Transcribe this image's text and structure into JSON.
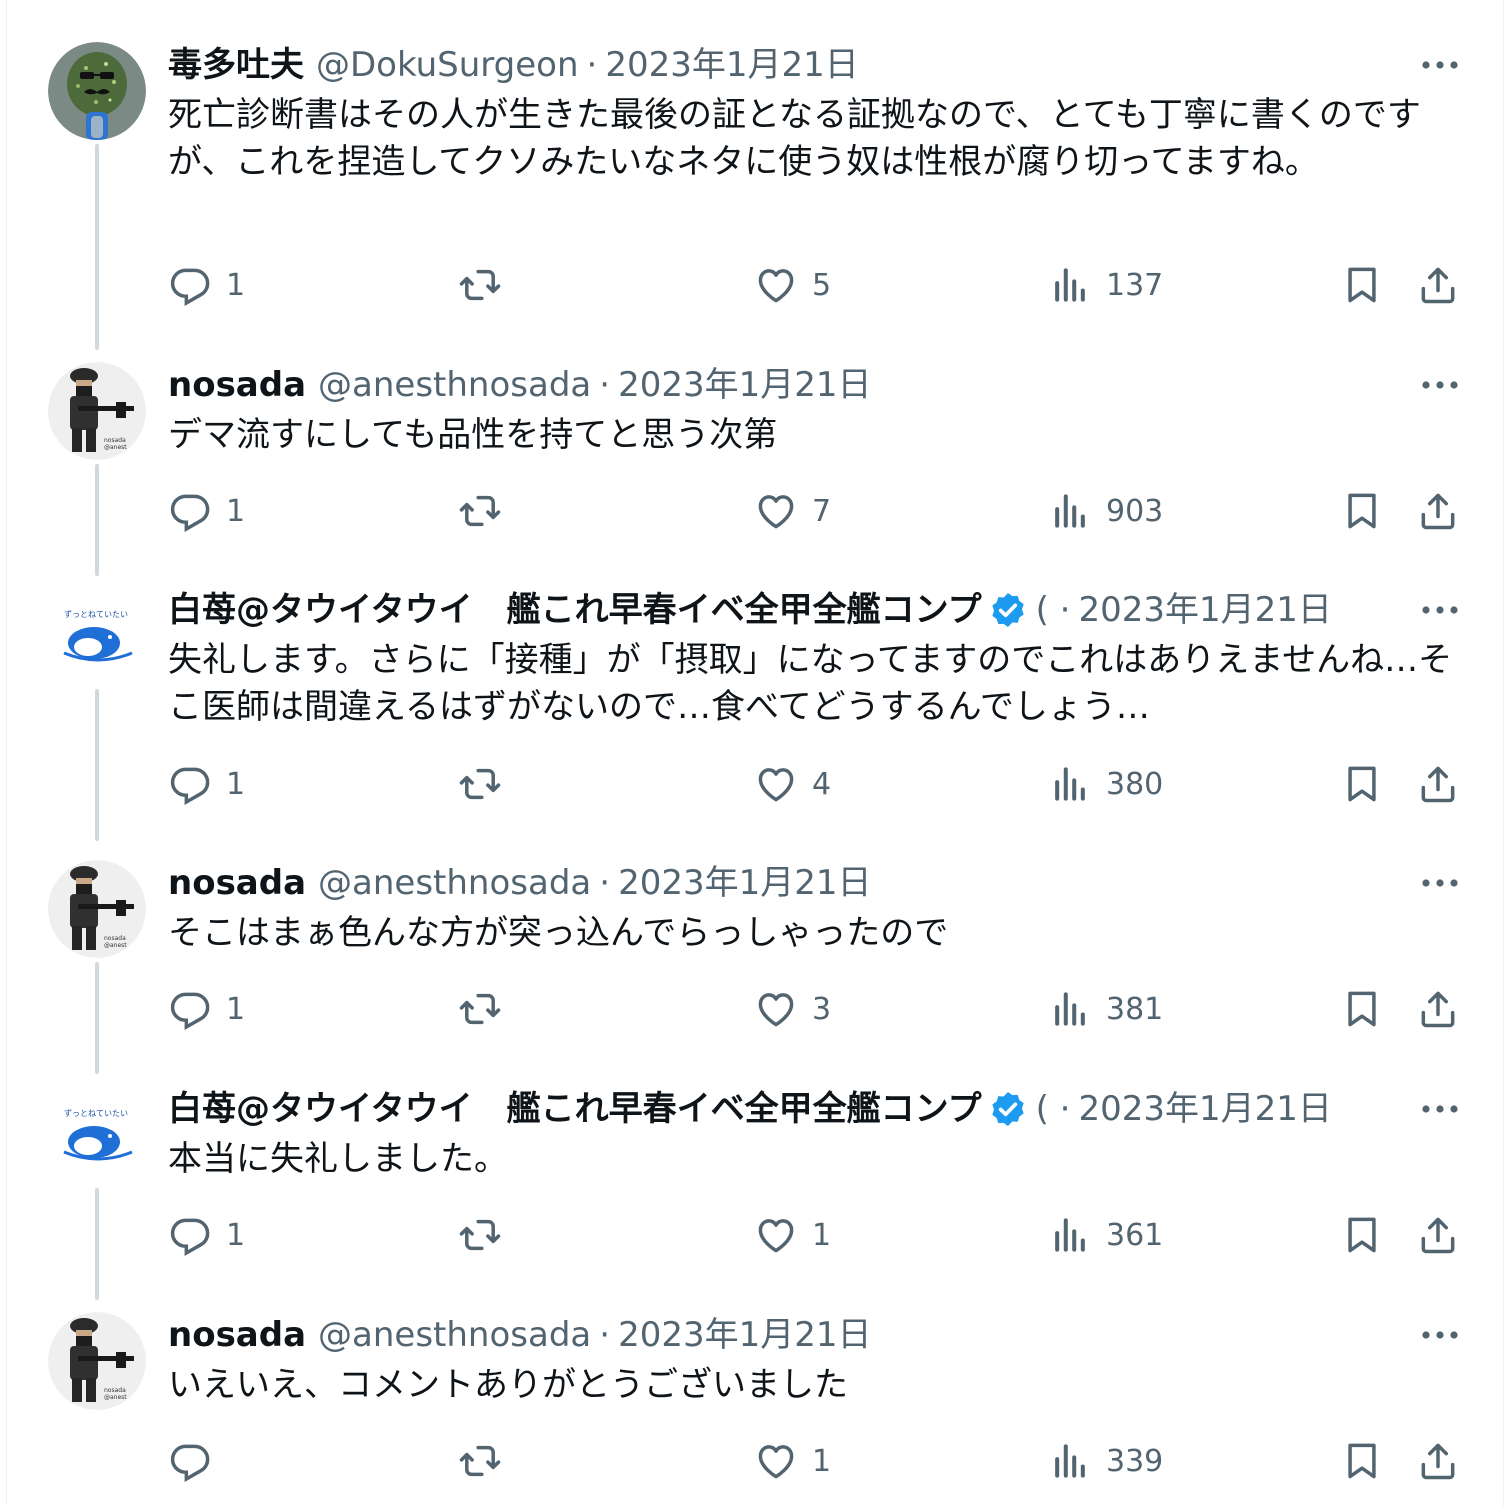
{
  "tweets": [
    {
      "name": "毒多吐夫",
      "handle": "@DokuSurgeon",
      "date": "2023年1月21日",
      "avatar_icon": "green-textured-mask-avatar",
      "verified": false,
      "text": "死亡診断書はその人が生きた最後の証となる証拠なので、とても丁寧に書くのですが、これを捏造してクソみたいなネタに使う奴は性根が腐り切ってますね。",
      "replies": "1",
      "likes": "5",
      "views": "137"
    },
    {
      "name": "nosada",
      "handle": "@anesthnosada",
      "date": "2023年1月21日",
      "avatar_icon": "soldier-figure-avatar",
      "verified": false,
      "text": "デマ流すにしても品性を持てと思う次第",
      "replies": "1",
      "likes": "7",
      "views": "903"
    },
    {
      "name": "白苺@タウイタウイ　艦これ早春イベ全甲全艦コンプ",
      "handle": "(",
      "date": "2023年1月21日",
      "avatar_icon": "penguin-illustration-avatar",
      "verified": true,
      "text": "失礼します。さらに「接種」が「摂取」になってますのでこれはありえませんね…そこ医師は間違えるはずがないので…食べてどうするんでしょう…",
      "replies": "1",
      "likes": "4",
      "views": "380"
    },
    {
      "name": "nosada",
      "handle": "@anesthnosada",
      "date": "2023年1月21日",
      "avatar_icon": "soldier-figure-avatar",
      "verified": false,
      "text": "そこはまぁ色んな方が突っ込んでらっしゃったので",
      "replies": "1",
      "likes": "3",
      "views": "381"
    },
    {
      "name": "白苺@タウイタウイ　艦これ早春イベ全甲全艦コンプ",
      "handle": "(",
      "date": "2023年1月21日",
      "avatar_icon": "penguin-illustration-avatar",
      "verified": true,
      "text": "本当に失礼しました。",
      "replies": "1",
      "likes": "1",
      "views": "361"
    },
    {
      "name": "nosada",
      "handle": "@anesthnosada",
      "date": "2023年1月21日",
      "avatar_icon": "soldier-figure-avatar",
      "verified": false,
      "text": "いえいえ、コメントありがとうございました",
      "replies": "",
      "likes": "1",
      "views": "339"
    }
  ],
  "icons": {
    "reply": "reply-icon",
    "retweet": "retweet-icon",
    "like": "heart-icon",
    "views": "views-chart-icon",
    "bookmark": "bookmark-icon",
    "share": "share-icon",
    "more": "more-dots-icon",
    "verified": "verified-badge-icon"
  },
  "colors": {
    "text": "#0f1419",
    "secondary": "#536471",
    "verified": "#1d9bf0",
    "connector": "#cfd9de"
  },
  "avatar_overlay_text": {
    "soldier": [
      "nosada",
      "@anest"
    ],
    "penguin": "ずっとねていたい"
  }
}
